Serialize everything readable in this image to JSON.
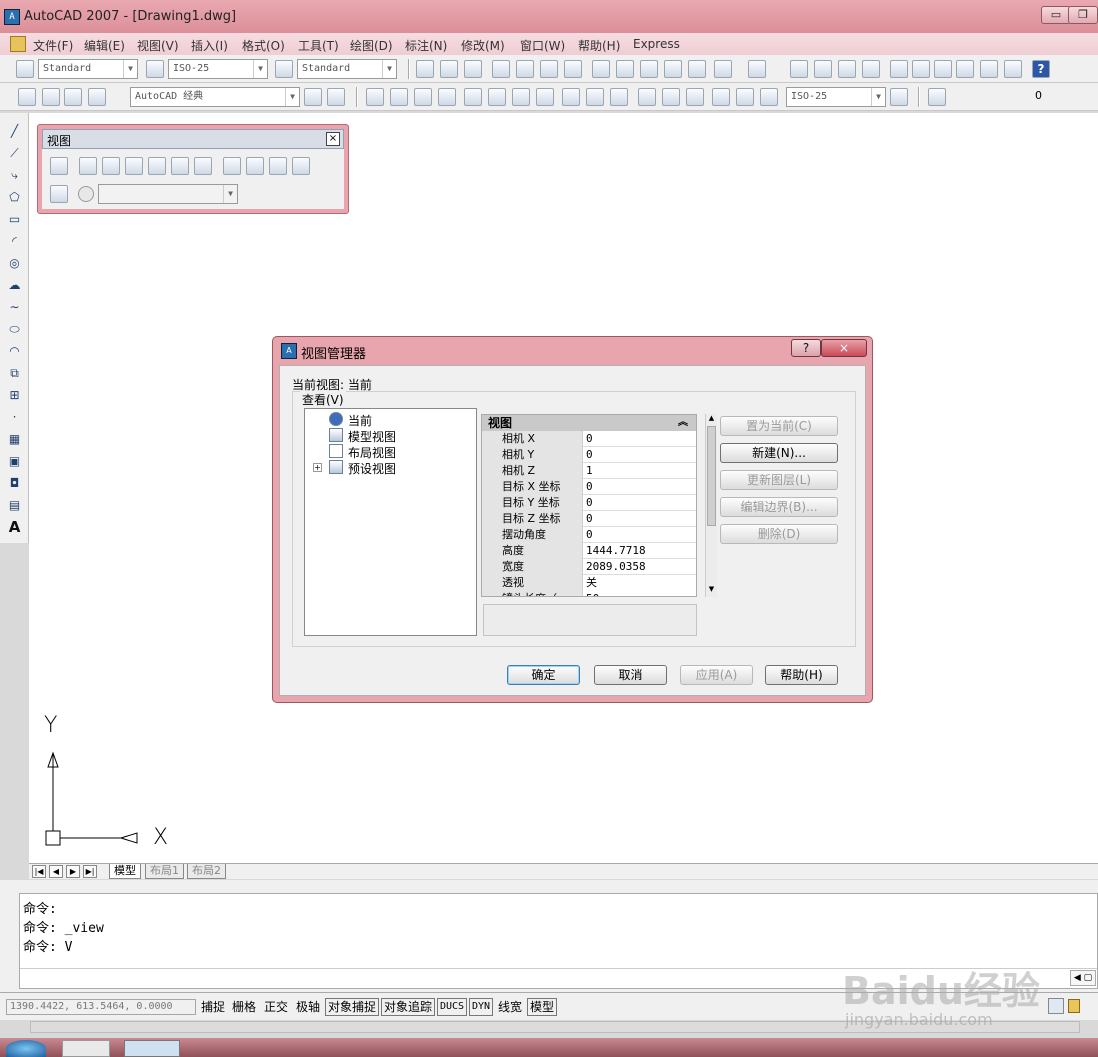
{
  "window": {
    "title": "AutoCAD 2007 - [Drawing1.dwg]",
    "app_icon": "A"
  },
  "menu": [
    "文件(F)",
    "编辑(E)",
    "视图(V)",
    "插入(I)",
    "格式(O)",
    "工具(T)",
    "绘图(D)",
    "标注(N)",
    "修改(M)",
    "窗口(W)",
    "帮助(H)",
    "Express"
  ],
  "styles": {
    "text_style": "Standard",
    "dim_style": "ISO-25",
    "table_style": "Standard",
    "workspace": "AutoCAD 经典",
    "dim_style2": "ISO-25",
    "layer_count": "0"
  },
  "view_toolbar": {
    "title": "视图",
    "close": "×"
  },
  "dialog": {
    "title": "视图管理器",
    "help_btn": "?",
    "close_btn": "×",
    "current_view_label": "当前视图: 当前",
    "group_label": "查看(V)",
    "tree": [
      {
        "label": "当前",
        "expander": ""
      },
      {
        "label": "模型视图",
        "expander": ""
      },
      {
        "label": "布局视图",
        "expander": ""
      },
      {
        "label": "预设视图",
        "expander": "+"
      }
    ],
    "props_header": "视图",
    "props": [
      {
        "k": "相机 X",
        "v": "0"
      },
      {
        "k": "相机 Y",
        "v": "0"
      },
      {
        "k": "相机 Z",
        "v": "1"
      },
      {
        "k": "目标 X 坐标",
        "v": "0"
      },
      {
        "k": "目标 Y 坐标",
        "v": "0"
      },
      {
        "k": "目标 Z 坐标",
        "v": "0"
      },
      {
        "k": "摆动角度",
        "v": "0"
      },
      {
        "k": "高度",
        "v": "1444.7718"
      },
      {
        "k": "宽度",
        "v": "2089.0358"
      },
      {
        "k": "透视",
        "v": "关"
      },
      {
        "k": "镜头长度（",
        "v": "50"
      }
    ],
    "side_buttons": [
      "置为当前(C)",
      "新建(N)...",
      "更新图层(L)",
      "编辑边界(B)...",
      "删除(D)"
    ],
    "bottom_buttons": [
      "确定",
      "取消",
      "应用(A)",
      "帮助(H)"
    ]
  },
  "ucs": {
    "x": "X",
    "y": "Y"
  },
  "layout_tabs": [
    "模型",
    "布局1",
    "布局2"
  ],
  "command_lines": [
    "命令:",
    "命令: _view",
    "命令: V"
  ],
  "status": {
    "coords": "1390.4422, 613.5464, 0.0000",
    "toggles": [
      "捕捉",
      "栅格",
      "正交",
      "极轴",
      "对象捕捉",
      "对象追踪",
      "DUCS",
      "DYN",
      "线宽",
      "模型"
    ]
  },
  "watermark": {
    "main": "Baidu经验",
    "sub": "jingyan.baidu.com"
  }
}
